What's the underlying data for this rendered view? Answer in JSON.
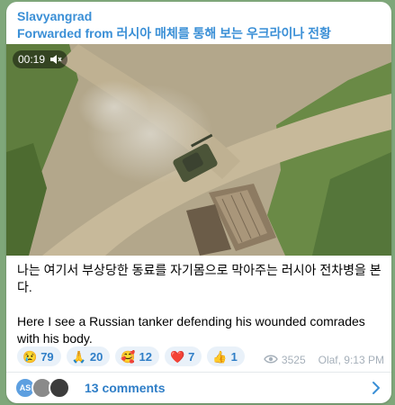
{
  "message": {
    "sender": "Slavyangrad",
    "forwarded_from": "Forwarded from 러시아 매체를 통해 보는 우크라이나 전황",
    "video": {
      "duration": "00:19",
      "mute_icon": "speaker-muted-icon"
    },
    "text_korean": "나는 여기서 부상당한 동료를 자기몸으로 막아주는 러시아 전차병을 본다.",
    "text_english": "Here I see a Russian tanker defending his wounded comrades with his body.",
    "reactions": [
      {
        "emoji": "😢",
        "count": "79"
      },
      {
        "emoji": "🙏",
        "count": "20"
      },
      {
        "emoji": "🥰",
        "count": "12"
      },
      {
        "emoji": "❤️",
        "count": "7"
      },
      {
        "emoji": "👍",
        "count": "1"
      }
    ],
    "views": "3525",
    "author_time": "Olaf, 9:13 PM",
    "comments": {
      "label": "13 comments",
      "avatar_initials": "AS"
    }
  },
  "colors": {
    "accent": "#3a8fd6",
    "chat_background": "#7fa77a",
    "reaction_bg": "#e9f1f9"
  }
}
